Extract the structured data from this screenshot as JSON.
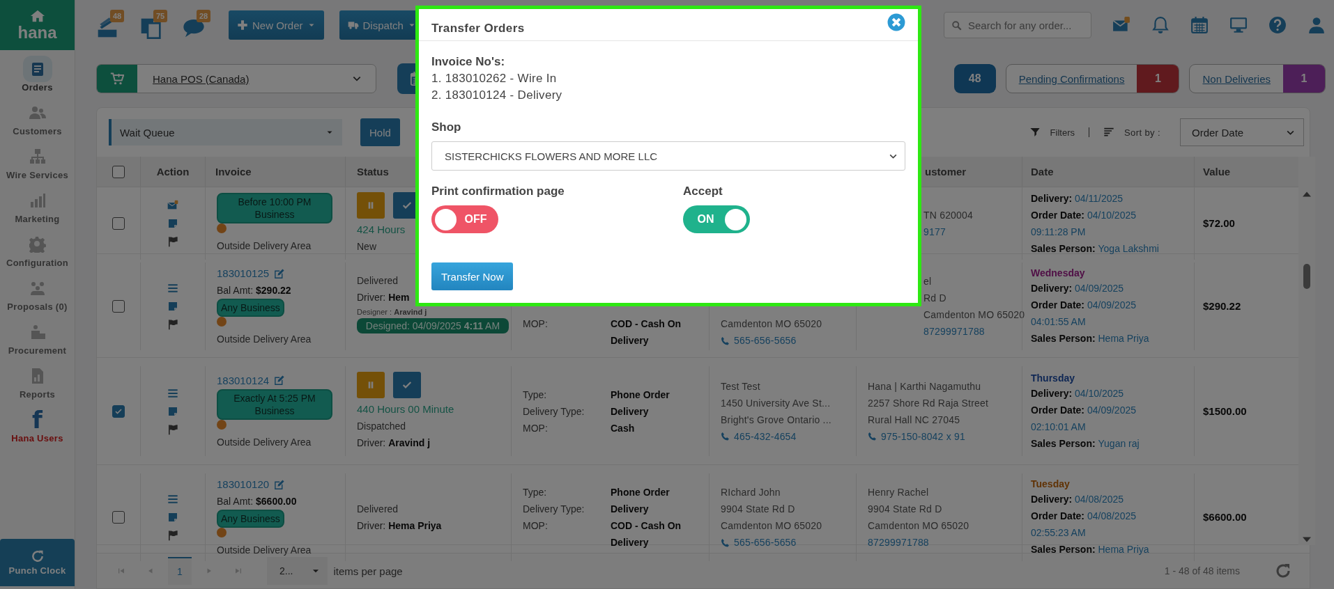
{
  "sidebar": {
    "logo": "hana",
    "items": [
      {
        "label": "Orders",
        "selected": true,
        "highlighted": false
      },
      {
        "label": "Customers",
        "selected": false,
        "highlighted": false
      },
      {
        "label": "Wire Services",
        "selected": false,
        "highlighted": false
      },
      {
        "label": "Marketing",
        "selected": false,
        "highlighted": false
      },
      {
        "label": "Configuration",
        "selected": false,
        "highlighted": false
      },
      {
        "label": "Proposals (0)",
        "selected": false,
        "highlighted": false
      },
      {
        "label": "Procurement",
        "selected": false,
        "highlighted": false
      },
      {
        "label": "Reports",
        "selected": false,
        "highlighted": false
      },
      {
        "label": "Hana Users",
        "glyph": "f",
        "selected": false,
        "highlighted": true
      }
    ],
    "punch_clock": "Punch Clock"
  },
  "topbar": {
    "counters": [
      "48",
      "75",
      "28"
    ],
    "buttons": [
      "New Order",
      "Dispatch"
    ],
    "search": {
      "placeholder": "Search for any order..."
    }
  },
  "shop_selector": {
    "value": "Hana POS (Canada)"
  },
  "summary_counts": [
    {
      "count": "48"
    },
    {
      "label": "Pending Confirmations",
      "count": "1"
    },
    {
      "label": "Non Deliveries",
      "count": "1"
    }
  ],
  "toolbar": {
    "queue": "Wait Queue",
    "hold": "Hold",
    "filters": "Filters",
    "sort_label": "Sort by :",
    "sort_value": "Order Date"
  },
  "table": {
    "select_all": false,
    "columns": [
      {
        "kind": "action",
        "label": "Action"
      },
      {
        "kind": "invoice",
        "label": "Invoice"
      },
      {
        "kind": "status",
        "label": "Status"
      },
      {
        "kind": "customer",
        "label": "ustomer"
      },
      {
        "kind": "date",
        "label": "Date"
      },
      {
        "kind": "value",
        "label": "Value"
      }
    ],
    "rows": [
      {
        "selected": false,
        "invoice": {
          "badge": "Before 10:00 PM Business",
          "area": "Outside Delivery Area"
        },
        "status": {
          "buttons": true,
          "timer": "424 Hours",
          "state": "New"
        },
        "customer": {
          "lines": [
            {
              "kind": "text",
              "text": "TN 620004"
            },
            {
              "kind": "link",
              "text": "9177"
            }
          ]
        },
        "date": {
          "delivery_label": "Delivery:",
          "delivery": "04/11/2025",
          "order_label": "Order Date:",
          "order_date": "04/10/2025",
          "order_time": "09:11:28 PM",
          "sales_label": "Sales Person:",
          "sales_person": "Yoga Lakshmi"
        },
        "value": "$72.00"
      },
      {
        "selected": false,
        "invoice": {
          "number": "183010125",
          "bal_label": "Bal Amt:",
          "bal": "$290.22",
          "badge": "Any Business",
          "area": "Outside Delivery Area"
        },
        "status": {
          "state": "Delivered",
          "driver_label": "Driver:",
          "driver": "Hem",
          "designer_label": "Designer :",
          "designer": "Aravind j",
          "designed": "Designed: 04/09/2025 **4:11** AM"
        },
        "type": {
          "pairs": [
            {
              "label": "MOP:",
              "value": "COD - Cash On Delivery"
            }
          ]
        },
        "recipient": {
          "lines": [
            {
              "kind": "text",
              "text": "Camdenton MO 65020"
            },
            {
              "kind": "phone",
              "text": "565-656-5656"
            }
          ]
        },
        "customer": {
          "lines": [
            {
              "kind": "text",
              "text": "el"
            },
            {
              "kind": "text",
              "text": "Rd D"
            },
            {
              "kind": "text",
              "text": "Camdenton MO 65020"
            },
            {
              "kind": "link",
              "text": "87299971788"
            }
          ]
        },
        "date": {
          "day": "Wednesday",
          "delivery_label": "Delivery:",
          "delivery": "04/09/2025",
          "order_label": "Order Date:",
          "order_date": "04/09/2025",
          "order_time": "04:01:55 AM",
          "sales_label": "Sales Person:",
          "sales_person": "Hema Priya"
        },
        "value": "$290.22"
      },
      {
        "selected": true,
        "invoice": {
          "number": "183010124",
          "badge": "Exactly At 5:25 PM Business",
          "area": "Outside Delivery Area"
        },
        "status": {
          "buttons": true,
          "timer": "440 Hours 00 Minute",
          "state": "Dispatched",
          "driver_label": "Driver:",
          "driver": "Aravind j"
        },
        "type": {
          "pairs": [
            {
              "label": "Type:",
              "value": "Phone Order"
            },
            {
              "label": "Delivery Type:",
              "value": "Delivery"
            },
            {
              "label": "MOP:",
              "value": "Cash"
            }
          ]
        },
        "recipient": {
          "lines": [
            {
              "kind": "text",
              "text": "Test Test"
            },
            {
              "kind": "text",
              "text": "1450 University Ave St..."
            },
            {
              "kind": "text",
              "text": "Bright's Grove Ontario ..."
            },
            {
              "kind": "phone",
              "text": "465-432-4654"
            }
          ]
        },
        "customer": {
          "lines": [
            {
              "kind": "text",
              "text": "Hana | Karthi Nagamuthu"
            },
            {
              "kind": "text",
              "text": "2257 Shore Rd Raja Street"
            },
            {
              "kind": "text",
              "text": "Rural Hall NC 27045"
            },
            {
              "kind": "phone",
              "text": "975-150-8042 x 91"
            }
          ]
        },
        "date": {
          "day": "Thursday",
          "delivery_label": "Delivery:",
          "delivery": "04/10/2025",
          "order_label": "Order Date:",
          "order_date": "04/09/2025",
          "order_time": "02:10:01 AM",
          "sales_label": "Sales Person:",
          "sales_person": "Yugan raj"
        },
        "value": "$1500.00"
      },
      {
        "selected": false,
        "invoice": {
          "number": "183010120",
          "bal_label": "Bal Amt:",
          "bal": "$6600.00",
          "badge": "Any Business",
          "area": "Outside Delivery Area"
        },
        "status": {
          "state": "Delivered",
          "driver_label": "Driver:",
          "driver": "Hema Priya"
        },
        "type": {
          "pairs": [
            {
              "label": "Type:",
              "value": "Phone Order"
            },
            {
              "label": "Delivery Type:",
              "value": "Delivery"
            },
            {
              "label": "MOP:",
              "value": "COD - Cash On Delivery"
            }
          ]
        },
        "recipient": {
          "lines": [
            {
              "kind": "text",
              "text": "RIchard John"
            },
            {
              "kind": "text",
              "text": "9904 State Rd D"
            },
            {
              "kind": "text",
              "text": "Camdenton MO 65020"
            },
            {
              "kind": "phone",
              "text": "565-656-5656"
            }
          ]
        },
        "customer": {
          "lines": [
            {
              "kind": "text",
              "text": "Henry Rachel"
            },
            {
              "kind": "text",
              "text": "9904 State Rd D"
            },
            {
              "kind": "text",
              "text": "Camdenton MO 65020"
            },
            {
              "kind": "link",
              "text": "87299971788"
            }
          ]
        },
        "date": {
          "day": "Tuesday",
          "delivery_label": "Delivery:",
          "delivery": "04/08/2025",
          "order_label": "Order Date:",
          "order_date": "04/08/2025",
          "order_time": "02:55:23 AM",
          "sales_label": "Sales Person:",
          "sales_person": "Hema Priya"
        },
        "value": "$6600.00"
      }
    ]
  },
  "pagination": {
    "pages": [
      {
        "label": "1",
        "selected": true
      }
    ],
    "page_size": "2...",
    "per_page_label": "items per page",
    "summary": "1 - 48 of 48 items"
  },
  "modal": {
    "title": "Transfer Orders",
    "invoices_label": "Invoice No's:",
    "invoices": [
      "1. 183010262 - Wire In",
      "2. 183010124 - Delivery"
    ],
    "shop_label": "Shop",
    "shop": "SISTERCHICKS FLOWERS AND MORE LLC",
    "toggles": [
      {
        "label": "Print confirmation page",
        "on": false,
        "text": "OFF"
      },
      {
        "label": "Accept",
        "on": true,
        "text": "ON"
      }
    ],
    "submit": "Transfer Now"
  }
}
